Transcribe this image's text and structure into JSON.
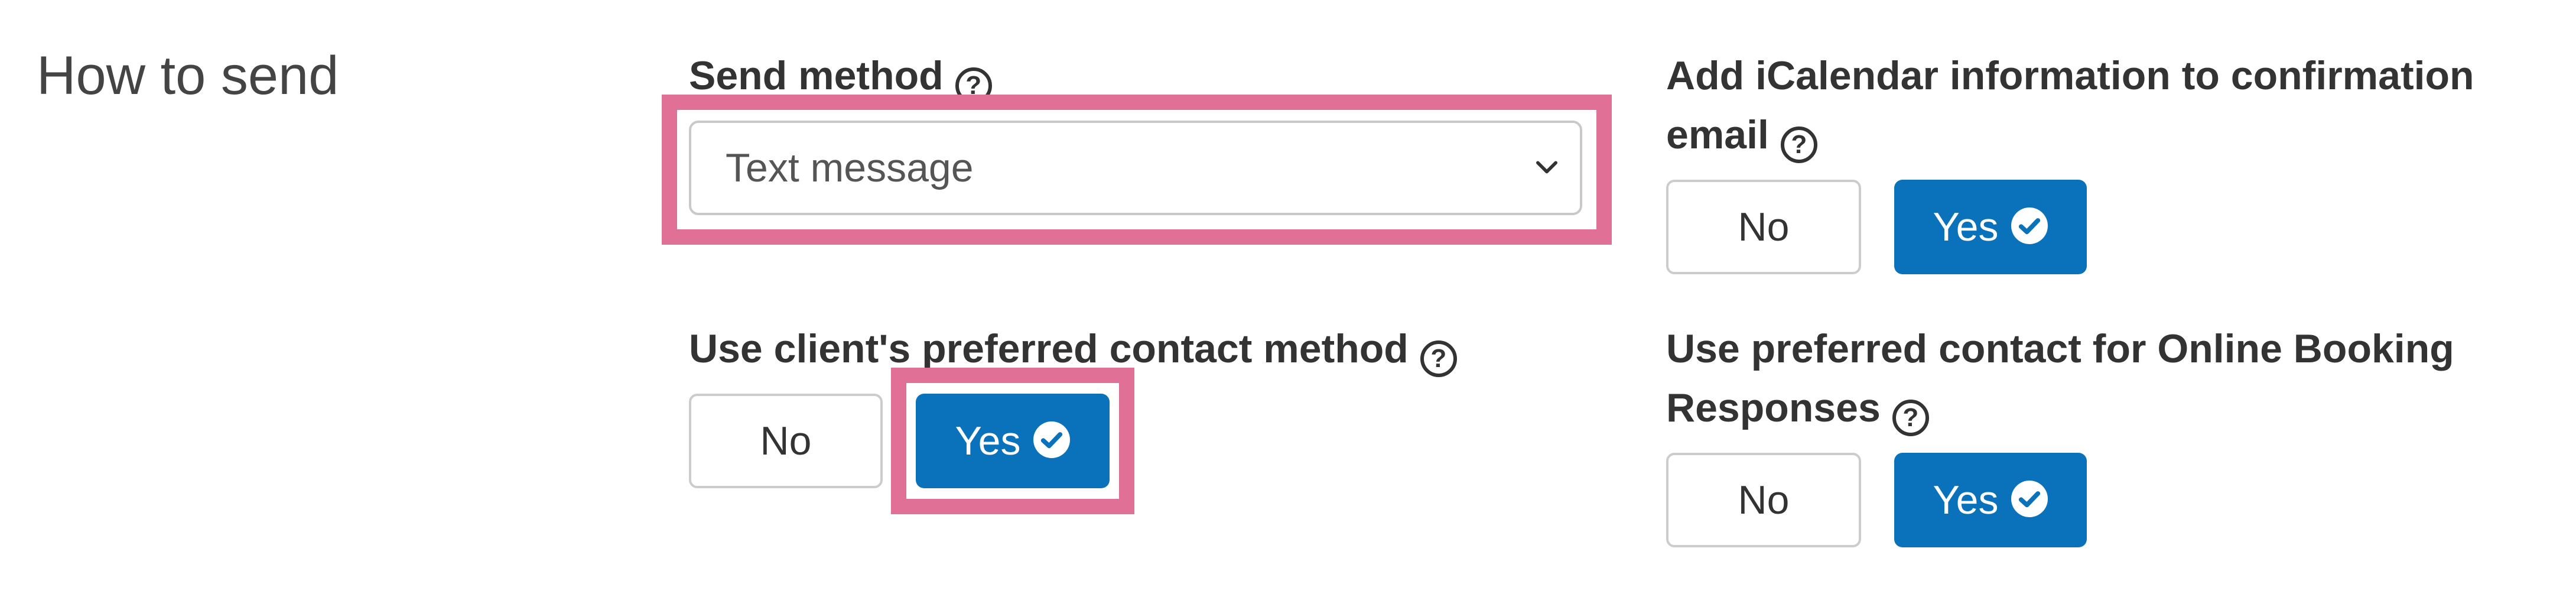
{
  "section": {
    "title": "How to send"
  },
  "send_method": {
    "label": "Send method",
    "selected_value": "Text message"
  },
  "icalendar": {
    "label_line1": "Add iCalendar information to confirmation",
    "label_line2": "email",
    "no_label": "No",
    "yes_label": "Yes",
    "selected": "Yes"
  },
  "preferred_contact": {
    "label": "Use client's preferred contact method",
    "no_label": "No",
    "yes_label": "Yes",
    "selected": "Yes"
  },
  "online_booking": {
    "label_line1": "Use preferred contact for Online Booking",
    "label_line2": "Responses",
    "no_label": "No",
    "yes_label": "Yes",
    "selected": "Yes"
  },
  "icons": {
    "help": "help-circle-icon",
    "check": "check-circle-icon",
    "chevron": "chevron-down-icon"
  },
  "colors": {
    "primary": "#0a72bb",
    "highlight": "#e07095",
    "text": "#333333",
    "border": "#cccccc"
  }
}
